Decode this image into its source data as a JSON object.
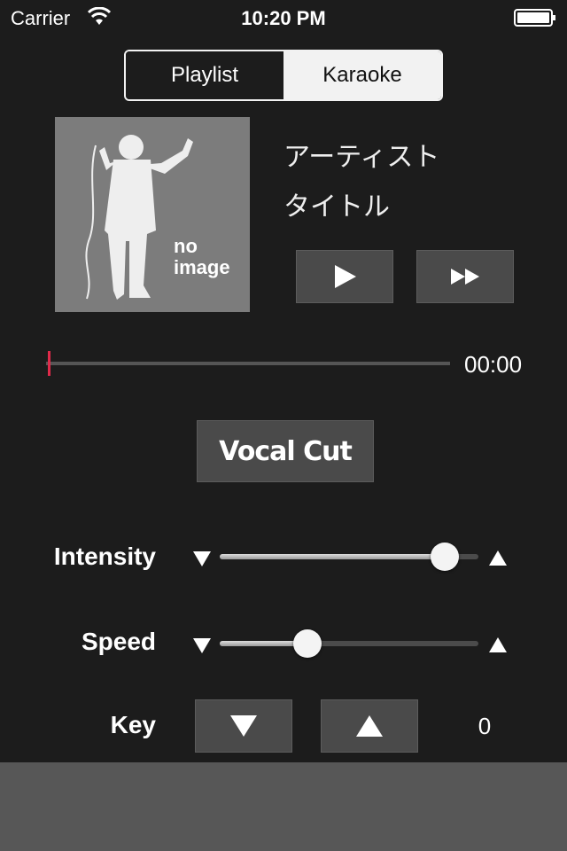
{
  "status_bar": {
    "carrier": "Carrier",
    "time": "10:20 PM",
    "icons": [
      "wifi-icon",
      "battery-icon"
    ]
  },
  "segmented": {
    "tabs": [
      {
        "label": "Playlist",
        "selected": false
      },
      {
        "label": "Karaoke",
        "selected": true
      }
    ]
  },
  "now_playing": {
    "artwork_text_line1": "no",
    "artwork_text_line2": "image",
    "artist": "アーティスト",
    "title": "タイトル",
    "controls": [
      "play-icon",
      "fast-forward-icon"
    ]
  },
  "progress": {
    "elapsed": "00:00",
    "value": 0
  },
  "vocal_cut": {
    "label": "Vocal Cut"
  },
  "controls": {
    "intensity": {
      "label": "Intensity",
      "value": 0.87
    },
    "speed": {
      "label": "Speed",
      "value": 0.34
    },
    "key": {
      "label": "Key",
      "value": "0"
    }
  },
  "colors": {
    "background": "#1c1c1c",
    "accent_marker": "#e02a4a",
    "button": "#4a4a4a",
    "bottom_bar": "#575757"
  }
}
